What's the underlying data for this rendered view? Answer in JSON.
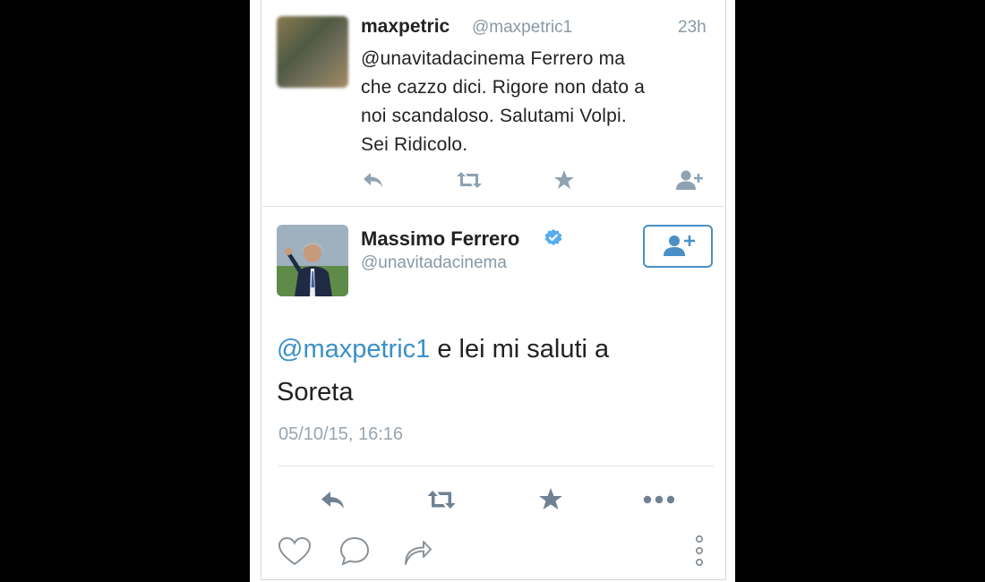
{
  "tweet_reply": {
    "author_name": "maxpetric",
    "author_handle": "@maxpetric1",
    "time_ago": "23h",
    "text_lines": [
      "@unavitadacinema Ferrero ma",
      "che cazzo dici. Rigore non dato a",
      "noi scandaloso. Salutami Volpi.",
      "Sei Ridicolo."
    ],
    "actions": [
      "reply-icon",
      "retweet-icon",
      "favorite-icon",
      "follow-icon"
    ]
  },
  "tweet_main": {
    "author_name": "Massimo Ferrero",
    "author_handle": "@unavitadacinema",
    "verified": true,
    "mention": "@maxpetric1",
    "text_after_mention": " e lei mi saluti a",
    "text_line2": "Soreta",
    "timestamp": "05/10/15, 16:16",
    "actions": [
      "reply-icon",
      "retweet-icon",
      "favorite-icon",
      "more-icon"
    ],
    "bottom_actions": [
      "like-icon",
      "comment-icon",
      "share-icon",
      "menu-icon"
    ]
  },
  "colors": {
    "accent": "#3a90c8",
    "icon_gray": "#8899a6",
    "verified_blue": "#55acee"
  }
}
